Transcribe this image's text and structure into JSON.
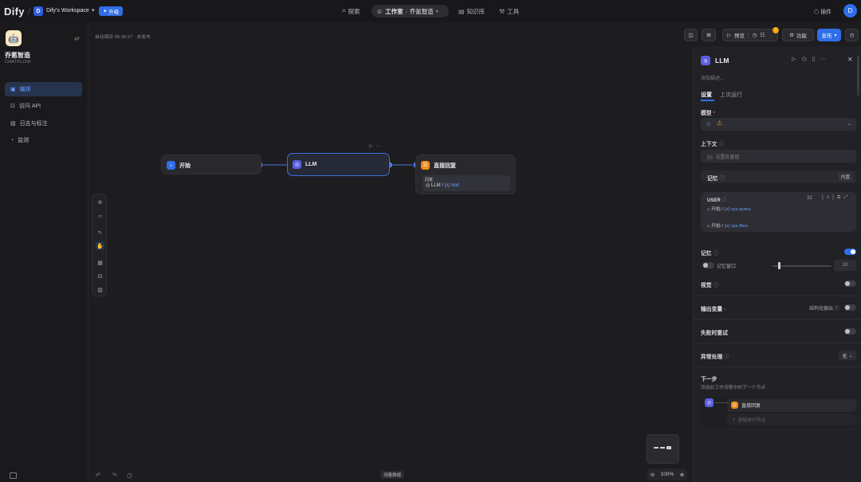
{
  "topbar": {
    "logo": "Dify",
    "workspace_initial": "D",
    "workspace_name": "Dify's Workspace",
    "upgrade_label": "升级",
    "nav": {
      "explore": "探索",
      "studio": "工作室",
      "app_crumb": "乔氪智造",
      "knowledge": "知识库",
      "tools": "工具"
    },
    "plugins": "插件",
    "user_initial": "D"
  },
  "sidebar": {
    "app_name": "乔氪智造",
    "app_type": "CHATFLOW",
    "items": [
      {
        "label": "编排",
        "icon": "layout-icon",
        "active": true
      },
      {
        "label": "访问 API",
        "icon": "terminal-icon",
        "active": false
      },
      {
        "label": "日志与标注",
        "icon": "file-text-icon",
        "active": false
      },
      {
        "label": "监测",
        "icon": "dashboard-icon",
        "active": false
      }
    ]
  },
  "canvas": {
    "autosave": "自动保存 05:36:27 · 未发布",
    "toolbar": {
      "preview": "预览",
      "features": "功能",
      "publish": "发布",
      "checklist_count": "1"
    },
    "nodes": {
      "start": {
        "title": "开始"
      },
      "llm": {
        "title": "LLM"
      },
      "answer": {
        "title": "直接回复",
        "field_label": "回复",
        "ref_node": "LLM",
        "ref_var": "text"
      }
    },
    "canvas_hint": "测量微缩",
    "zoom": "100%"
  },
  "panel": {
    "title": "LLM",
    "description_placeholder": "添加描述...",
    "tabs": {
      "settings": "设置",
      "last_run": "上次运行"
    },
    "model_label": "模型",
    "context_label": "上下文",
    "context_placeholder": "设置变量值",
    "memory_label": "记忆",
    "memory_badge": "内置",
    "prompt": {
      "role": "USER",
      "token_count": "32",
      "var1_node": "开始",
      "var1_name": "sys.query",
      "var2_node": "开始",
      "var2_name": "sys.files"
    },
    "memory_toggle_label": "记忆",
    "memory_on": true,
    "memory_window_label": "记忆窗口",
    "memory_window_value": "10",
    "vision_label": "视觉",
    "output_vars_label": "输出变量",
    "structured_output_label": "结构化输出",
    "retry_label": "失败时重试",
    "error_handling_label": "异常处理",
    "error_handling_value": "无",
    "next_step_label": "下一步",
    "next_step_desc": "添加此工作流程中的下一个节点",
    "next_node": "直接回复",
    "add_parallel": "添加并行节点"
  },
  "colors": {
    "accent": "#2f6ee8",
    "llm": "#5b5fe0",
    "answer": "#f08a1c",
    "warning": "#f59e0b"
  }
}
